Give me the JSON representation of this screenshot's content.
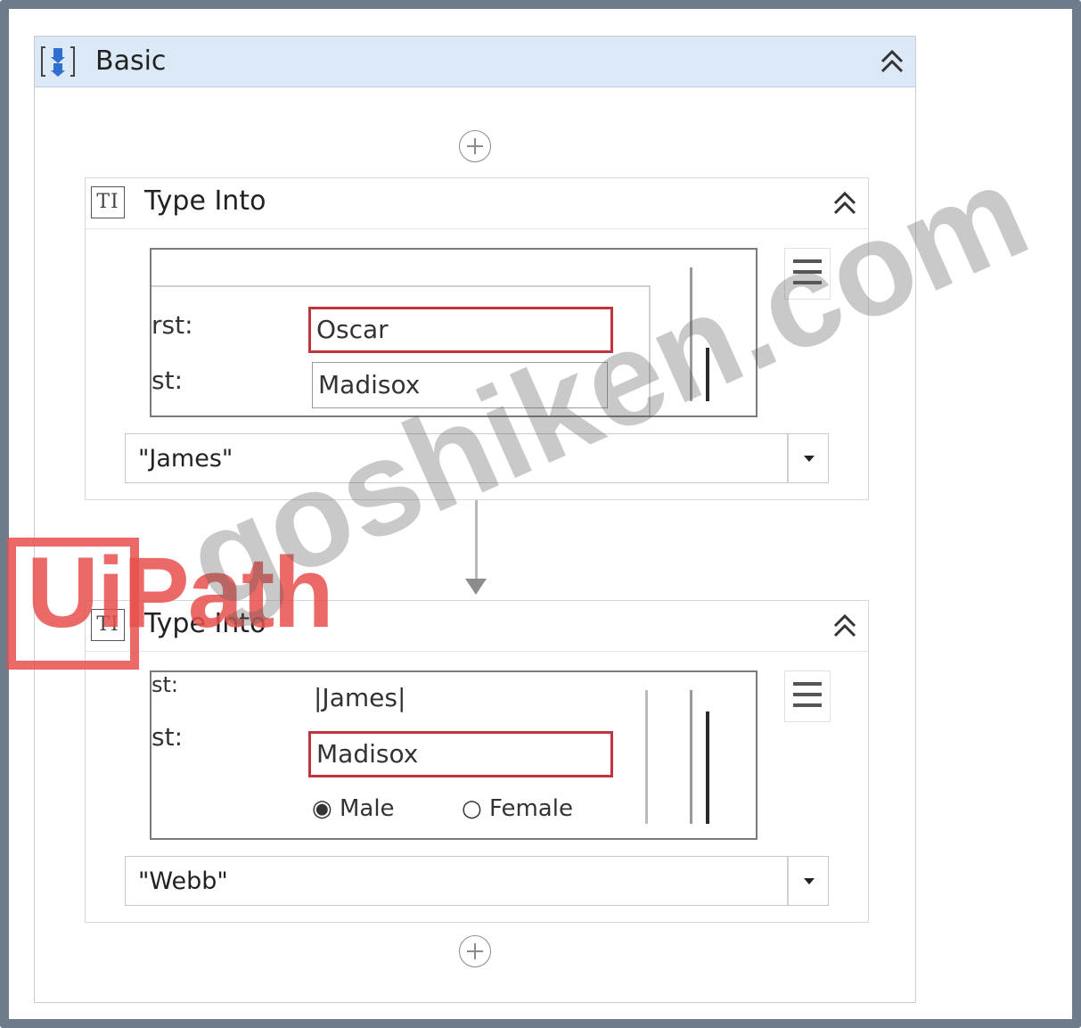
{
  "sequence": {
    "title": "Basic",
    "icon": "sequence-icon",
    "collapse_icon": "double-chevron-up-icon"
  },
  "activities": [
    {
      "title": "Type Into",
      "icon_text": "TI",
      "preview": {
        "labels": [
          "rst:",
          "st:"
        ],
        "fields": [
          "Oscar",
          "Madisox"
        ],
        "selected_field": "Oscar"
      },
      "value": "\"James\"",
      "menu_icon": "hamburger-menu-icon",
      "dropdown_icon": "dropdown-arrow-icon"
    },
    {
      "title": "Type Into",
      "icon_text": "TI",
      "preview": {
        "labels": [
          "st:",
          "st:"
        ],
        "fields": [
          "|James|",
          "Madisox"
        ],
        "selected_field": "Madisox",
        "radio_male": "Male",
        "radio_female": "Female",
        "radio_selected": "Male"
      },
      "value": "\"Webb\"",
      "menu_icon": "hamburger-menu-icon",
      "dropdown_icon": "dropdown-arrow-icon"
    }
  ],
  "watermarks": {
    "logo": "UiPath",
    "site": "goshiken.com"
  },
  "colors": {
    "header_bg": "#dbe9f7",
    "selected_border": "#c0343b",
    "frame": "#6e7b8b"
  }
}
